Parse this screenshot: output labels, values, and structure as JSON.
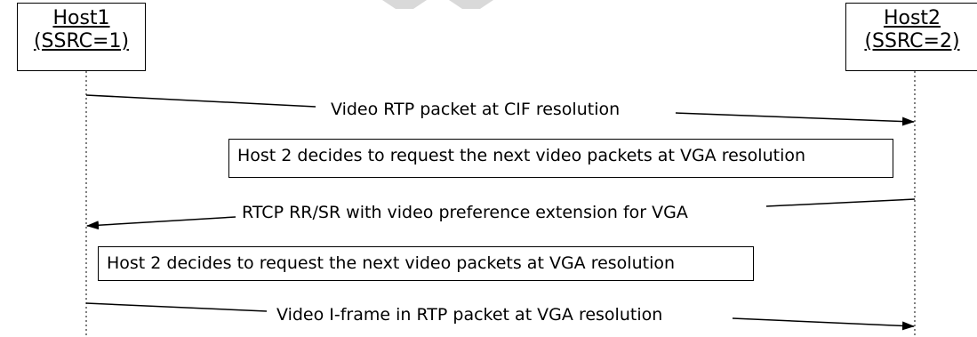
{
  "hosts": [
    {
      "name": "Host1",
      "ssrc": "(SSRC=1)"
    },
    {
      "name": "Host2",
      "ssrc": "(SSRC=2)"
    }
  ],
  "messages": [
    {
      "label": "Video RTP packet at CIF resolution",
      "from": "Host1",
      "to": "Host2"
    },
    {
      "label": "RTCP RR/SR with video preference extension for VGA",
      "from": "Host2",
      "to": "Host1"
    },
    {
      "label": "Video I-frame in RTP packet at VGA resolution",
      "from": "Host1",
      "to": "Host2"
    }
  ],
  "notes": [
    {
      "text": "Host 2 decides to request the next video packets at VGA resolution"
    },
    {
      "text": "Host 2 decides to request the next video packets at VGA resolution"
    }
  ]
}
